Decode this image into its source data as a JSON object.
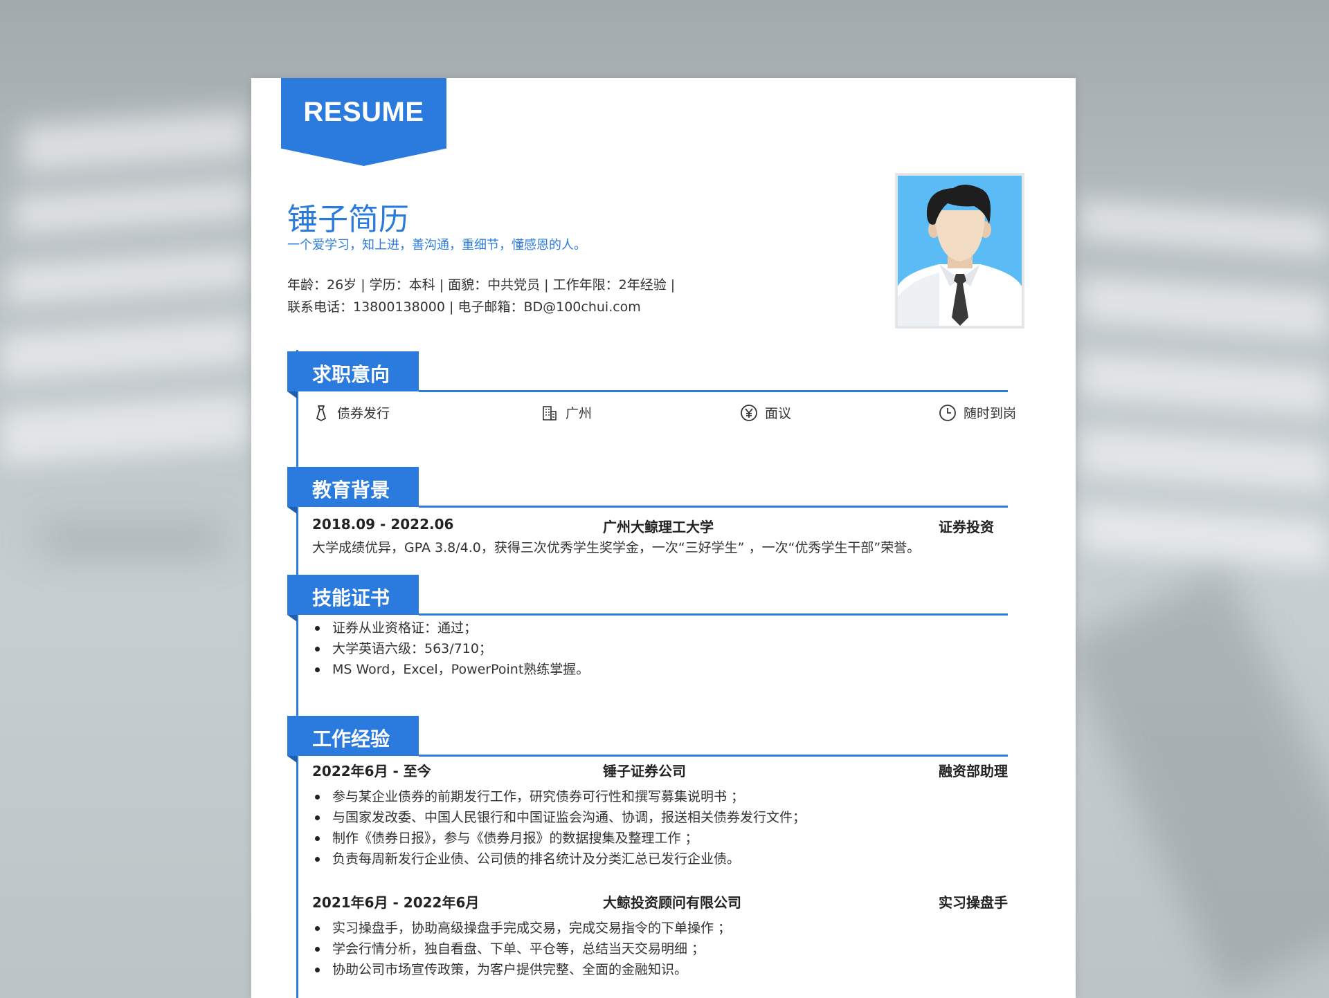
{
  "badge": "RESUME",
  "profile": {
    "name": "锤子简历",
    "motto": "一个爱学习，知上进，善沟通，重细节，懂感恩的人。",
    "info_line1": "年龄：26岁 | 学历：本科 | 面貌：中共党员 | 工作年限：2年经验 |",
    "info_line2": "联系电话：13800138000 | 电子邮箱：BD@100chui.com"
  },
  "sections": {
    "intent_title": "求职意向",
    "education_title": "教育背景",
    "skills_title": "技能证书",
    "work_title": "工作经验"
  },
  "intent": {
    "position": "债券发行",
    "city": "广州",
    "salary": "面议",
    "availability": "随时到岗"
  },
  "education": {
    "period": "2018.09 - 2022.06",
    "school": "广州大鲸理工大学",
    "major": "证券投资",
    "description": "大学成绩优异，GPA 3.8/4.0，获得三次优秀学生奖学金，一次“三好学生” ，一次“优秀学生干部”荣誉。"
  },
  "skills": [
    "证券从业资格证：通过；",
    "大学英语六级：563/710；",
    "MS Word，Excel，PowerPoint熟练掌握。"
  ],
  "work": [
    {
      "period": "2022年6月 - 至今",
      "company": "锤子证券公司",
      "role": "融资部助理",
      "duties": [
        "参与某企业债券的前期发行工作，研究债券可行性和撰写募集说明书 ；",
        "与国家发改委、中国人民银行和中国证监会沟通、协调，报送相关债券发行文件；",
        "制作《债券日报》，参与《债券月报》的数据搜集及整理工作 ；",
        "负责每周新发行企业债、公司债的排名统计及分类汇总已发行企业债。"
      ]
    },
    {
      "period": "2021年6月 - 2022年6月",
      "company": "大鲸投资顾问有限公司",
      "role": "实习操盘手",
      "duties": [
        "实习操盘手，协助高级操盘手完成交易，完成交易指令的下单操作 ；",
        "学会行情分析，独自看盘、下单、平仓等，总结当天交易明细 ；",
        "协助公司市场宣传政策，为客户提供完整、全面的金融知识。"
      ]
    }
  ],
  "colors": {
    "accent": "#2b7bde",
    "photo_bg": "#5bbcf5",
    "text": "#333333"
  },
  "icons": [
    "tie-icon",
    "building-icon",
    "yen-icon",
    "clock-icon"
  ]
}
